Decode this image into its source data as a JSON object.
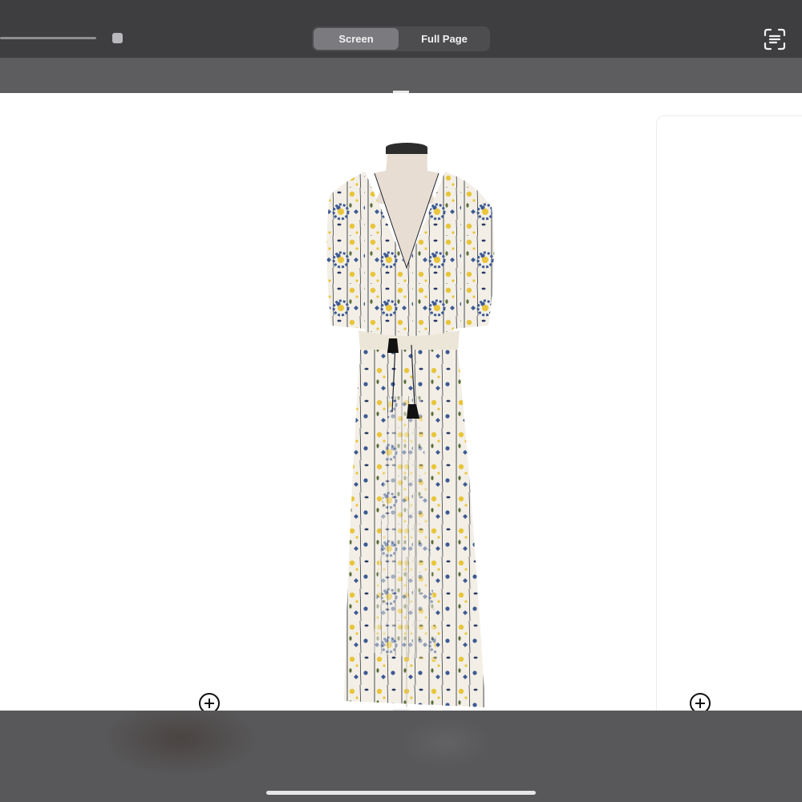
{
  "toolbar": {
    "segments": {
      "screen_label": "Screen",
      "full_page_label": "Full Page",
      "selected": "Screen"
    },
    "icons": {
      "scan": "text-scan-icon",
      "zoom": "zoom-in-icon"
    }
  },
  "product": {
    "image": "product-photo"
  },
  "colors": {
    "toolbar_bg": "#3e3e40",
    "segment_selected": "#7b7b7f",
    "page_bg": "#ffffff",
    "dress_base": "#f3efe6",
    "flower_yellow": "#e8c53a",
    "flower_blue": "#3e5a93"
  }
}
